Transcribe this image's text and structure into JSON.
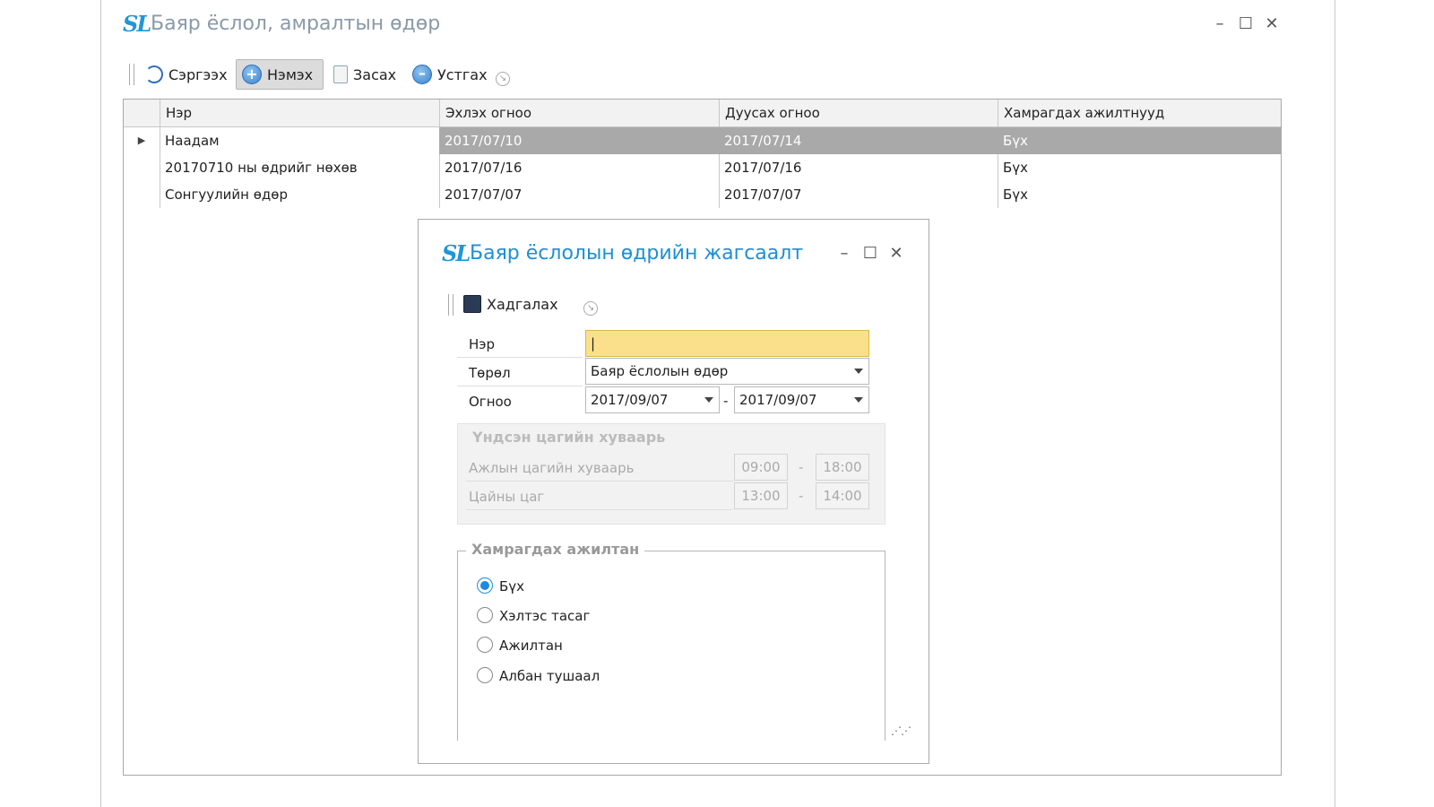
{
  "main_window": {
    "logo": "SL",
    "title": "Баяр ёслол, амралтын өдөр",
    "controls": {
      "minimize": "–",
      "maximize": "☐",
      "close": "✕"
    },
    "toolbar": {
      "refresh_label": "Сэргээх",
      "add_label": "Нэмэх",
      "edit_label": "Засах",
      "delete_label": "Устгах"
    },
    "grid": {
      "columns": [
        "Нэр",
        "Эхлэх огноо",
        "Дуусах огноо",
        "Хамрагдах ажилтнууд"
      ],
      "rows": [
        {
          "name": "Наадам",
          "start": "2017/07/10",
          "end": "2017/07/14",
          "scope": "Бүх",
          "selected": true
        },
        {
          "name": "20170710 ны өдрийг нөхөв",
          "start": "2017/07/16",
          "end": "2017/07/16",
          "scope": "Бүх"
        },
        {
          "name": "Сонгуулийн өдөр",
          "start": "2017/07/07",
          "end": "2017/07/07",
          "scope": "Бүх"
        }
      ]
    }
  },
  "dialog": {
    "logo": "SL",
    "title": "Баяр ёслолын өдрийн жагсаалт",
    "controls": {
      "minimize": "–",
      "maximize": "☐",
      "close": "✕"
    },
    "save_label": "Хадгалах",
    "form": {
      "name_label": "Нэр",
      "name_value": "|",
      "type_label": "Төрөл",
      "type_value": "Баяр ёслолын өдөр",
      "date_label": "Огноо",
      "date_from": "2017/09/07",
      "date_to": "2017/09/07",
      "date_sep": "-"
    },
    "schedule_group": {
      "caption": "Үндсэн цагийн хуваарь",
      "work_label": "Ажлын цагийн хуваарь",
      "work_from": "09:00",
      "work_to": "18:00",
      "lunch_label": "Цайны цаг",
      "lunch_from": "13:00",
      "lunch_to": "14:00",
      "sep": "-"
    },
    "employees_group": {
      "caption": "Хамрагдах ажилтан",
      "options": [
        "Бүх",
        "Хэлтэс тасаг",
        "Ажилтан",
        "Албан тушаал"
      ],
      "selected_index": 0
    }
  }
}
